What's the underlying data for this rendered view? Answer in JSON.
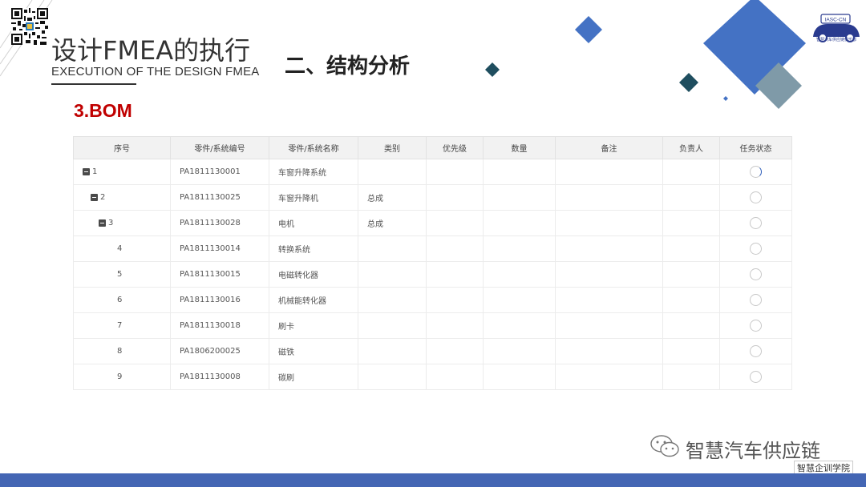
{
  "header": {
    "title": "设计FMEA的执行",
    "subtitle": "EXECUTION OF THE DESIGN FMEA",
    "section": "二、结构分析",
    "bom_label": "3.BOM"
  },
  "logo": {
    "badge": "IASC-CN",
    "caption": "智慧汽车供应链俱乐部"
  },
  "colors": {
    "accent_blue": "#4466b4",
    "diamond_blue": "#4472c4",
    "diamond_teal": "#1f4e5f",
    "bom_red": "#c00000"
  },
  "table": {
    "columns": [
      "序号",
      "零件/系统编号",
      "零件/系统名称",
      "类别",
      "优先级",
      "数量",
      "备注",
      "负责人",
      "任务状态"
    ],
    "rows": [
      {
        "seq": "1",
        "code": "PA1811130001",
        "name": "车窗升降系统",
        "category": "",
        "priority": "",
        "qty": "",
        "remark": "",
        "owner": "",
        "collapsible": true
      },
      {
        "seq": "2",
        "code": "PA1811130025",
        "name": "车窗升降机",
        "category": "总成",
        "priority": "",
        "qty": "",
        "remark": "",
        "owner": "",
        "collapsible": true
      },
      {
        "seq": "3",
        "code": "PA1811130028",
        "name": "电机",
        "category": "总成",
        "priority": "",
        "qty": "",
        "remark": "",
        "owner": "",
        "collapsible": true
      },
      {
        "seq": "4",
        "code": "PA1811130014",
        "name": "转换系统",
        "category": "",
        "priority": "",
        "qty": "",
        "remark": "",
        "owner": "",
        "collapsible": false
      },
      {
        "seq": "5",
        "code": "PA1811130015",
        "name": "电磁转化器",
        "category": "",
        "priority": "",
        "qty": "",
        "remark": "",
        "owner": "",
        "collapsible": false
      },
      {
        "seq": "6",
        "code": "PA1811130016",
        "name": "机械能转化器",
        "category": "",
        "priority": "",
        "qty": "",
        "remark": "",
        "owner": "",
        "collapsible": false
      },
      {
        "seq": "7",
        "code": "PA1811130018",
        "name": "刷卡",
        "category": "",
        "priority": "",
        "qty": "",
        "remark": "",
        "owner": "",
        "collapsible": false
      },
      {
        "seq": "8",
        "code": "PA1806200025",
        "name": "磁铁",
        "category": "",
        "priority": "",
        "qty": "",
        "remark": "",
        "owner": "",
        "collapsible": false
      },
      {
        "seq": "9",
        "code": "PA1811130008",
        "name": "碳刷",
        "category": "",
        "priority": "",
        "qty": "",
        "remark": "",
        "owner": "",
        "collapsible": false
      }
    ]
  },
  "footer": {
    "brand": "智慧汽车供应链",
    "academy": "智慧企训学院",
    "icons": [
      "qr-code-icon",
      "wechat-icon"
    ]
  }
}
